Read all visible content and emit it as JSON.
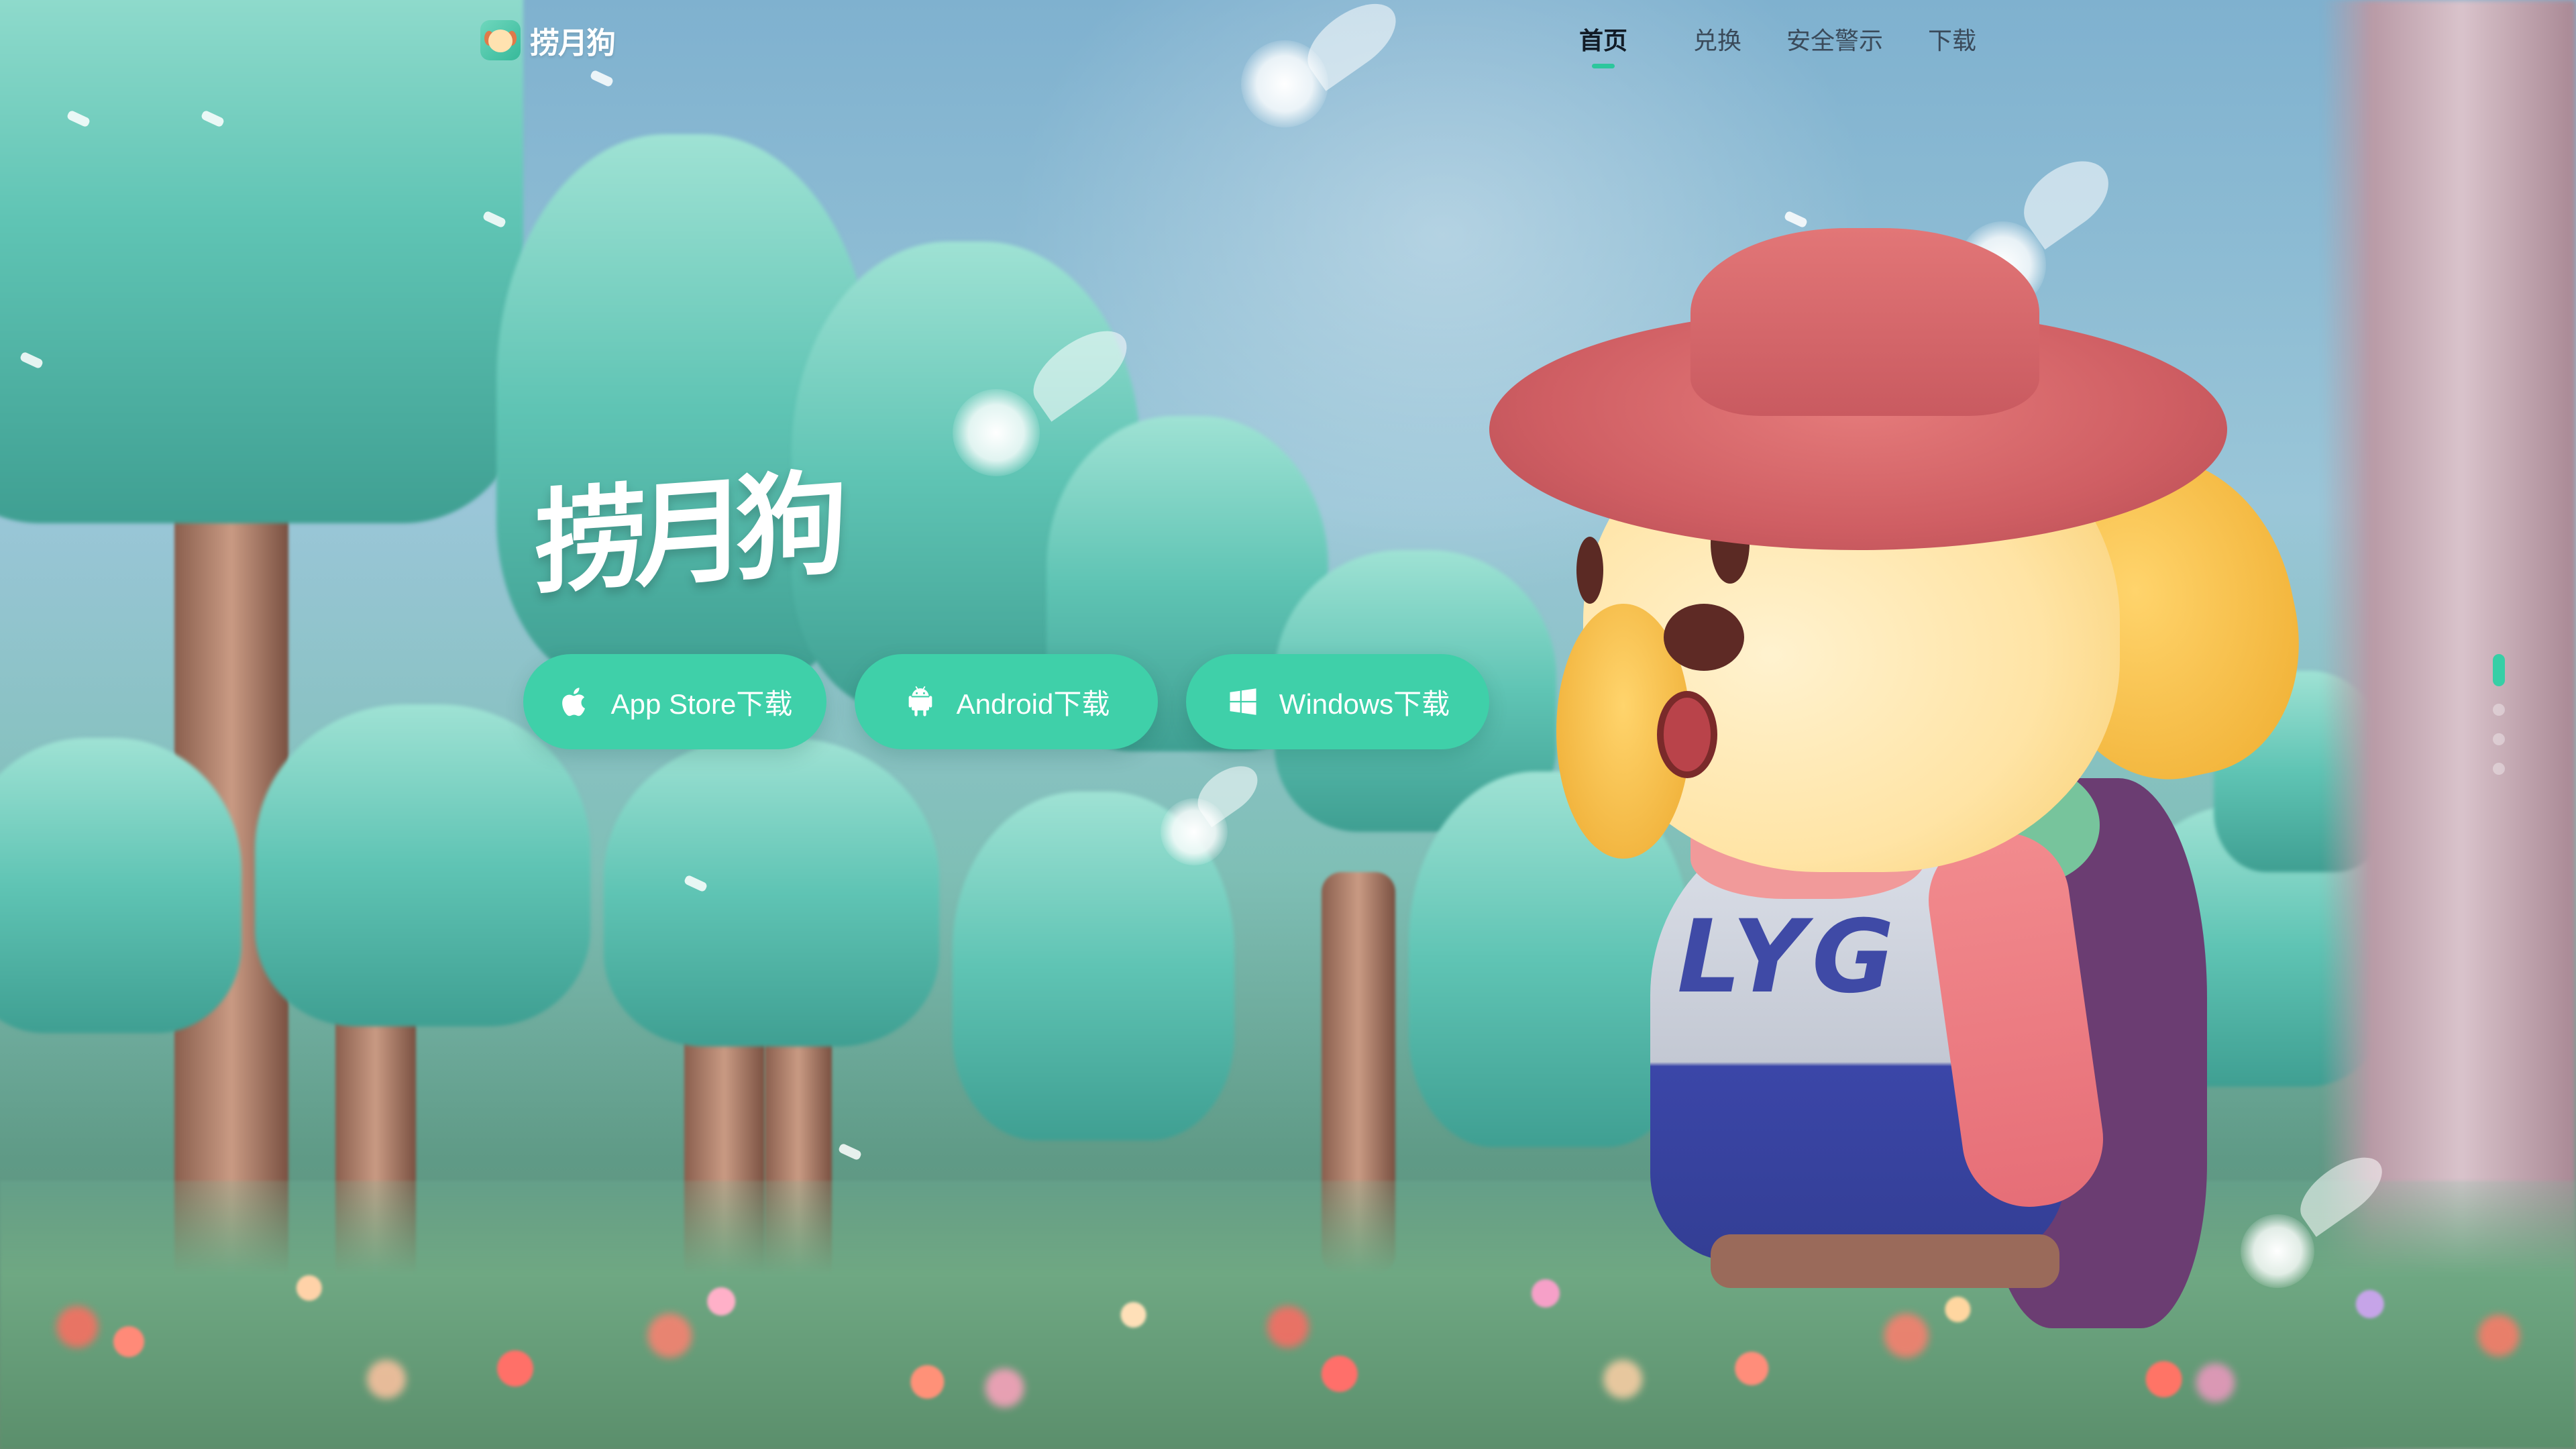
{
  "brand": {
    "logo_text": "捞月狗",
    "logo_icon": "dog-face-icon"
  },
  "nav": {
    "items": [
      {
        "label": "首页",
        "active": true
      },
      {
        "label": "兑换",
        "active": false
      },
      {
        "label": "安全警示",
        "active": false
      },
      {
        "label": "下载",
        "active": false
      }
    ]
  },
  "hero": {
    "title": "捞月狗",
    "character_shirt_text": "LYG"
  },
  "downloads": [
    {
      "label": "App Store下载",
      "icon": "apple-icon"
    },
    {
      "label": "Android下载",
      "icon": "android-icon"
    },
    {
      "label": "Windows下载",
      "icon": "windows-icon"
    }
  ],
  "pager": {
    "total": 4,
    "active_index": 0
  },
  "colors": {
    "accent": "#3fd0a9",
    "nav_active_underline": "#2cc79d",
    "pager_active": "#36cfa6"
  }
}
